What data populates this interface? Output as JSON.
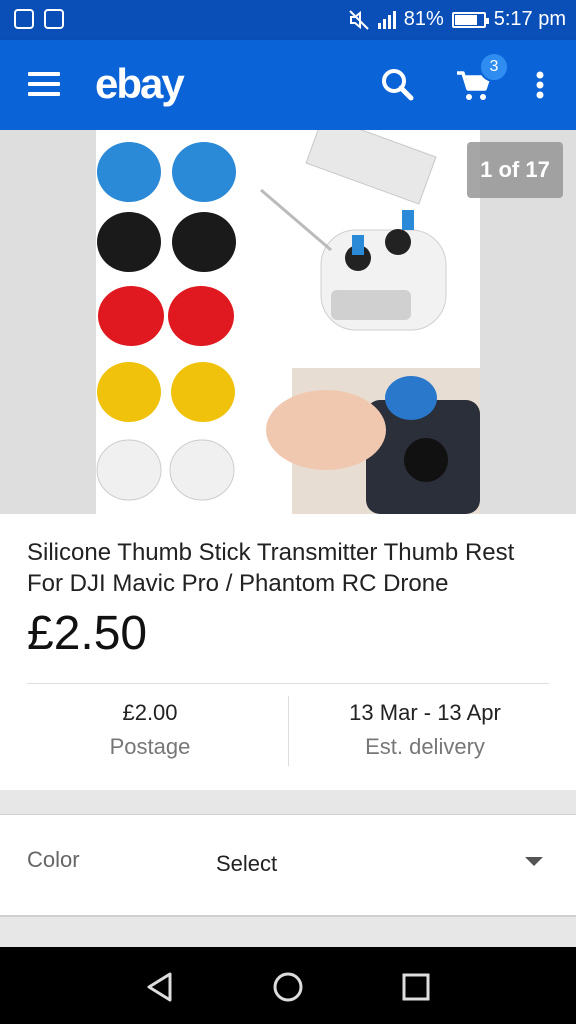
{
  "status_bar": {
    "battery": "81%",
    "time": "5:17 pm",
    "battery_level": 0.81
  },
  "header": {
    "logo": "ebay",
    "cart_count": "3",
    "icons": [
      "menu-icon",
      "search-icon",
      "cart-icon",
      "more-vert-icon"
    ]
  },
  "gallery": {
    "counter": "1 of 17"
  },
  "product": {
    "title": "Silicone Thumb Stick Transmitter Thumb Rest For DJI Mavic Pro / Phantom RC Drone",
    "price": "£2.50",
    "postage_value": "£2.00",
    "postage_label": "Postage",
    "delivery_value": "13 Mar - 13 Apr",
    "delivery_label": "Est. delivery"
  },
  "options": {
    "color_label": "Color",
    "color_value": "Select"
  },
  "nav": {
    "icons": [
      "back-icon",
      "home-icon",
      "recents-icon"
    ]
  },
  "colors": {
    "status_bar": "#0a4fb8",
    "app_bar": "#0b63d8",
    "badge": "#2f8cf0"
  }
}
